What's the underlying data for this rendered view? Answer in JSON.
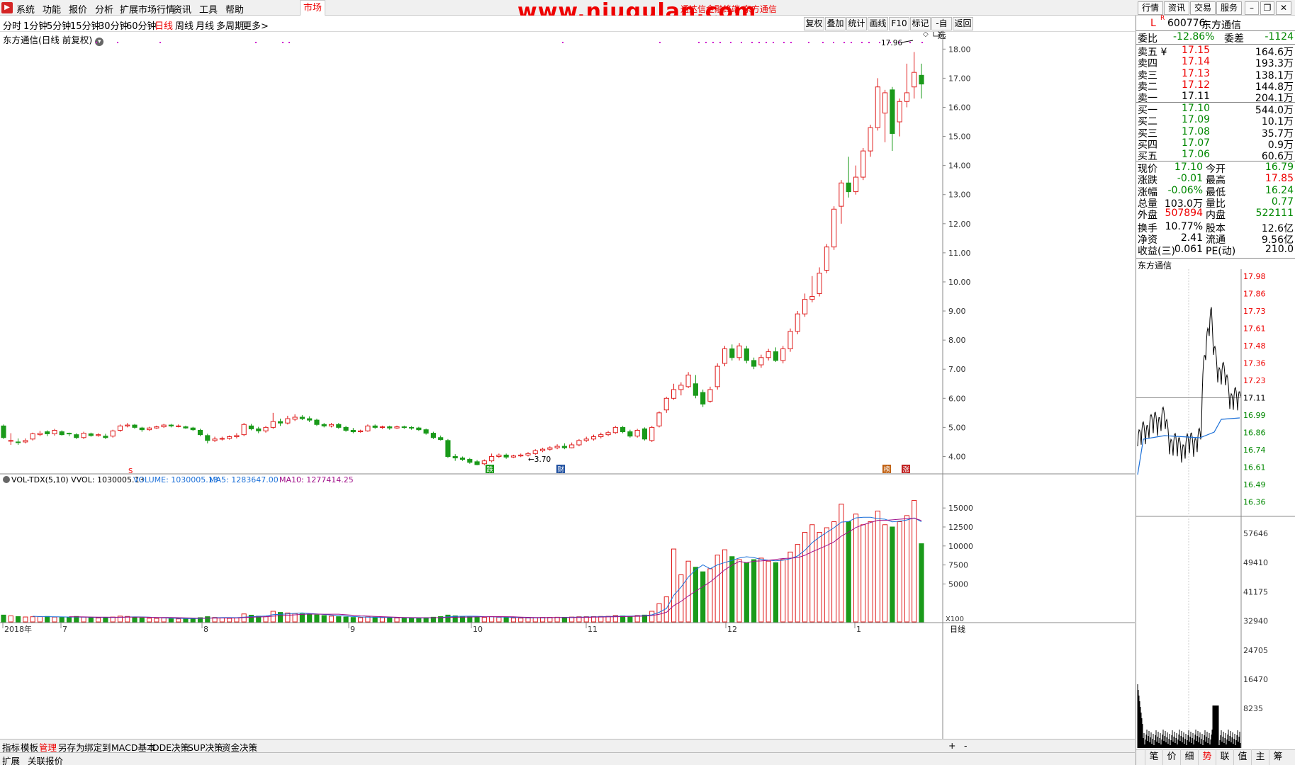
{
  "menu": [
    "系统",
    "功能",
    "报价",
    "分析",
    "扩展市场行情",
    "资讯",
    "工具",
    "帮助"
  ],
  "market_tab": "市场",
  "watermark": "www.niugulan.com",
  "window_title": "通达信金融终端 东方通信",
  "top_right": [
    "行情",
    "资讯",
    "交易",
    "服务"
  ],
  "periods": [
    "分时",
    "1分钟",
    "5分钟",
    "15分钟",
    "30分钟",
    "60分钟",
    "日线",
    "周线",
    "月线",
    "多周期",
    "更多>"
  ],
  "active_period": "日线",
  "tools": [
    "复权",
    "叠加",
    "统计",
    "画线",
    "F10",
    "标记",
    "-自选",
    "返回"
  ],
  "chart_title": "东方通信(日线 前复权)",
  "vol_label": {
    "name": "VOL-TDX(5,10)",
    "vvol": "VVOL: 1030005.13",
    "volume": "VOLUME: 1030005.13",
    "ma5": "MA5: 1283647.00",
    "ma10": "MA10: 1277414.25"
  },
  "vol_unit": "X100",
  "bottom_tabs": [
    "指标",
    "模板",
    "管理",
    "另存为",
    "绑定到",
    "MACD基本",
    "DDE决策",
    "SUP决策",
    "资金决策"
  ],
  "active_bottom_tab": "管理",
  "status": [
    "扩展",
    "关联报价"
  ],
  "daily_label": "日线",
  "markers": {
    "s": "S",
    "die": "跌",
    "cai": "财",
    "bang": "榜",
    "zhang": "涨",
    "low_label": "←3.70",
    "high_label": "17.96"
  },
  "quote": {
    "code_prefix": "L",
    "code_sup": "R",
    "code": "600776",
    "name": "东方通信",
    "weibi_label": "委比",
    "weibi": "-12.86%",
    "weicha_label": "委差",
    "weicha": "-1124",
    "asks": [
      {
        "label": "卖五",
        "price": "17.15",
        "vol": "164.6万"
      },
      {
        "label": "卖四",
        "price": "17.14",
        "vol": "193.3万"
      },
      {
        "label": "卖三",
        "price": "17.13",
        "vol": "138.1万"
      },
      {
        "label": "卖二",
        "price": "17.12",
        "vol": "144.8万"
      },
      {
        "label": "卖一",
        "price": "17.11",
        "vol": "204.1万"
      }
    ],
    "bids": [
      {
        "label": "买一",
        "price": "17.10",
        "vol": "544.0万"
      },
      {
        "label": "买二",
        "price": "17.09",
        "vol": "10.1万"
      },
      {
        "label": "买三",
        "price": "17.08",
        "vol": "35.7万"
      },
      {
        "label": "买四",
        "price": "17.07",
        "vol": "0.9万"
      },
      {
        "label": "买五",
        "price": "17.06",
        "vol": "60.6万"
      }
    ],
    "stats": [
      [
        "现价",
        "17.10",
        "今开",
        "16.79"
      ],
      [
        "涨跌",
        "-0.01",
        "最高",
        "17.85"
      ],
      [
        "涨幅",
        "-0.06%",
        "最低",
        "16.24"
      ],
      [
        "总量",
        "103.0万",
        "量比",
        "0.77"
      ],
      [
        "外盘",
        "507894",
        "内盘",
        "522111"
      ],
      [
        "换手",
        "10.77%",
        "股本",
        "12.6亿"
      ],
      [
        "净资",
        "2.41",
        "流通",
        "9.56亿"
      ],
      [
        "收益(三)",
        "0.061",
        "PE(动)",
        "210.0"
      ]
    ],
    "mini_title": "东方通信",
    "mini_price_ticks": [
      "17.98",
      "17.86",
      "17.73",
      "17.61",
      "17.48",
      "17.36",
      "17.23",
      "17.11",
      "16.99",
      "16.86",
      "16.74",
      "16.61",
      "16.49",
      "16.36"
    ],
    "mini_vol_ticks": [
      "57646",
      "49410",
      "41175",
      "32940",
      "24705",
      "16470",
      "8235"
    ],
    "bottom_tabs": [
      "笔",
      "价",
      "细",
      "势",
      "联",
      "值",
      "主",
      "筹"
    ]
  },
  "chart_data": {
    "type": "candlestick",
    "title": "东方通信(日线 前复权)",
    "price_axis": {
      "min": 3.5,
      "max": 18.3,
      "ticks": [
        4.0,
        5.0,
        6.0,
        7.0,
        8.0,
        9.0,
        10.0,
        11.0,
        12.0,
        13.0,
        14.0,
        15.0,
        16.0,
        17.0,
        18.0
      ]
    },
    "volume_axis": {
      "min": 0,
      "max": 18000,
      "ticks": [
        5000,
        7500,
        10000,
        12500,
        15000
      ]
    },
    "x_labels": [
      "2018年",
      "7",
      "8",
      "9",
      "10",
      "11",
      "12",
      "1"
    ],
    "candles": [
      [
        5.05,
        4.65,
        5.1,
        4.6,
        900
      ],
      [
        4.55,
        4.55,
        4.8,
        4.4,
        800
      ],
      [
        4.5,
        4.48,
        4.62,
        4.4,
        700
      ],
      [
        4.5,
        4.55,
        4.62,
        4.45,
        650
      ],
      [
        4.6,
        4.78,
        4.82,
        4.55,
        680
      ],
      [
        4.75,
        4.8,
        4.88,
        4.7,
        690
      ],
      [
        4.85,
        4.78,
        4.9,
        4.7,
        720
      ],
      [
        4.78,
        4.9,
        4.95,
        4.72,
        640
      ],
      [
        4.85,
        4.75,
        4.9,
        4.72,
        600
      ],
      [
        4.8,
        4.78,
        4.82,
        4.7,
        560
      ],
      [
        4.75,
        4.65,
        4.8,
        4.6,
        720
      ],
      [
        4.65,
        4.8,
        4.85,
        4.6,
        640
      ],
      [
        4.78,
        4.72,
        4.82,
        4.68,
        560
      ],
      [
        4.72,
        4.75,
        4.8,
        4.68,
        520
      ],
      [
        4.7,
        4.65,
        4.78,
        4.6,
        560
      ],
      [
        4.7,
        4.88,
        4.92,
        4.65,
        640
      ],
      [
        4.9,
        5.05,
        5.1,
        4.85,
        760
      ],
      [
        5.05,
        5.08,
        5.15,
        5.0,
        720
      ],
      [
        5.08,
        5.0,
        5.12,
        4.95,
        620
      ],
      [
        4.98,
        4.92,
        5.02,
        4.85,
        540
      ],
      [
        4.92,
        4.98,
        5.02,
        4.88,
        480
      ],
      [
        4.98,
        5.02,
        5.06,
        4.95,
        470
      ],
      [
        5.02,
        5.08,
        5.12,
        4.98,
        520
      ],
      [
        5.08,
        5.05,
        5.12,
        5.0,
        450
      ],
      [
        5.05,
        5.05,
        5.1,
        5.0,
        400
      ],
      [
        5.02,
        4.98,
        5.06,
        4.95,
        420
      ],
      [
        4.98,
        4.92,
        5.02,
        4.88,
        470
      ],
      [
        4.9,
        4.75,
        4.95,
        4.7,
        560
      ],
      [
        4.72,
        4.55,
        4.78,
        4.45,
        690
      ],
      [
        4.55,
        4.6,
        4.68,
        4.5,
        590
      ],
      [
        4.6,
        4.62,
        4.68,
        4.55,
        520
      ],
      [
        4.62,
        4.68,
        4.72,
        4.58,
        470
      ],
      [
        4.68,
        4.72,
        4.8,
        4.62,
        520
      ],
      [
        4.75,
        5.1,
        5.15,
        4.7,
        1050
      ],
      [
        5.05,
        4.95,
        5.12,
        4.9,
        890
      ],
      [
        4.95,
        4.88,
        5.02,
        4.8,
        760
      ],
      [
        4.88,
        5.0,
        5.05,
        4.82,
        690
      ],
      [
        5.0,
        5.2,
        5.5,
        4.95,
        1400
      ],
      [
        5.2,
        5.15,
        5.3,
        5.05,
        1250
      ],
      [
        5.15,
        5.3,
        5.4,
        5.1,
        1180
      ],
      [
        5.28,
        5.35,
        5.45,
        5.22,
        1100
      ],
      [
        5.35,
        5.3,
        5.42,
        5.25,
        1050
      ],
      [
        5.3,
        5.25,
        5.38,
        5.18,
        980
      ],
      [
        5.25,
        5.1,
        5.3,
        5.05,
        920
      ],
      [
        5.1,
        5.05,
        5.15,
        5.0,
        840
      ],
      [
        5.05,
        5.1,
        5.15,
        5.0,
        760
      ],
      [
        5.1,
        5.0,
        5.15,
        4.95,
        690
      ],
      [
        5.0,
        4.9,
        5.05,
        4.85,
        650
      ],
      [
        4.9,
        4.85,
        4.98,
        4.8,
        590
      ],
      [
        4.85,
        4.88,
        4.92,
        4.82,
        560
      ],
      [
        4.88,
        5.05,
        5.1,
        4.85,
        670
      ],
      [
        5.05,
        5.0,
        5.1,
        4.95,
        620
      ],
      [
        5.0,
        5.02,
        5.06,
        4.95,
        570
      ],
      [
        5.02,
        4.98,
        5.06,
        4.92,
        540
      ],
      [
        4.98,
        5.02,
        5.06,
        4.95,
        520
      ],
      [
        5.02,
        5.0,
        5.06,
        4.95,
        500
      ],
      [
        5.0,
        4.98,
        5.04,
        4.92,
        480
      ],
      [
        4.98,
        4.92,
        5.02,
        4.88,
        510
      ],
      [
        4.92,
        4.8,
        4.96,
        4.75,
        560
      ],
      [
        4.8,
        4.65,
        4.85,
        4.6,
        620
      ],
      [
        4.65,
        4.58,
        4.72,
        4.55,
        700
      ],
      [
        4.55,
        4.0,
        4.6,
        3.95,
        900
      ],
      [
        4.0,
        3.95,
        4.08,
        3.85,
        800
      ],
      [
        3.95,
        3.9,
        4.0,
        3.85,
        720
      ],
      [
        3.9,
        3.8,
        3.95,
        3.75,
        680
      ],
      [
        3.82,
        3.72,
        3.88,
        3.7,
        640
      ],
      [
        3.75,
        3.85,
        3.9,
        3.7,
        600
      ],
      [
        3.85,
        4.0,
        4.1,
        3.8,
        700
      ],
      [
        4.0,
        4.05,
        4.1,
        3.95,
        620
      ],
      [
        4.05,
        3.98,
        4.1,
        3.92,
        560
      ],
      [
        3.98,
        4.02,
        4.06,
        3.95,
        520
      ],
      [
        4.02,
        4.05,
        4.1,
        3.98,
        500
      ],
      [
        4.05,
        4.1,
        4.15,
        4.0,
        520
      ],
      [
        4.1,
        4.2,
        4.25,
        4.05,
        560
      ],
      [
        4.2,
        4.25,
        4.3,
        4.15,
        590
      ],
      [
        4.25,
        4.3,
        4.35,
        4.2,
        600
      ],
      [
        4.3,
        4.35,
        4.42,
        4.25,
        620
      ],
      [
        4.35,
        4.3,
        4.45,
        4.25,
        610
      ],
      [
        4.3,
        4.4,
        4.48,
        4.28,
        640
      ],
      [
        4.4,
        4.55,
        4.6,
        4.35,
        680
      ],
      [
        4.55,
        4.6,
        4.68,
        4.5,
        690
      ],
      [
        4.6,
        4.68,
        4.75,
        4.55,
        700
      ],
      [
        4.68,
        4.75,
        4.82,
        4.62,
        720
      ],
      [
        4.75,
        4.82,
        4.88,
        4.7,
        740
      ],
      [
        4.82,
        5.0,
        5.05,
        4.78,
        850
      ],
      [
        5.0,
        4.85,
        5.05,
        4.8,
        790
      ],
      [
        4.85,
        4.7,
        4.92,
        4.65,
        740
      ],
      [
        4.7,
        4.9,
        4.95,
        4.65,
        850
      ],
      [
        4.95,
        4.6,
        5.0,
        4.55,
        900
      ],
      [
        4.55,
        5.0,
        5.05,
        4.5,
        1400
      ],
      [
        5.05,
        5.5,
        5.55,
        5.0,
        2400
      ],
      [
        5.6,
        6.0,
        6.05,
        5.5,
        3300
      ],
      [
        6.0,
        6.3,
        6.5,
        5.95,
        9600
      ],
      [
        6.3,
        6.45,
        6.55,
        6.1,
        6200
      ],
      [
        6.4,
        6.8,
        6.9,
        6.35,
        8000
      ],
      [
        6.5,
        6.1,
        6.8,
        6.0,
        7200
      ],
      [
        6.2,
        5.8,
        6.3,
        5.7,
        6600
      ],
      [
        5.9,
        6.3,
        6.4,
        5.85,
        7000
      ],
      [
        6.4,
        7.1,
        7.2,
        6.3,
        8800
      ],
      [
        7.2,
        7.7,
        7.8,
        7.1,
        9500
      ],
      [
        7.7,
        7.4,
        7.85,
        7.3,
        8600
      ],
      [
        7.4,
        7.8,
        7.9,
        7.3,
        8200
      ],
      [
        7.7,
        7.3,
        7.8,
        7.2,
        7800
      ],
      [
        7.3,
        7.1,
        7.4,
        7.0,
        8200
      ],
      [
        7.15,
        7.4,
        7.5,
        7.05,
        8400
      ],
      [
        7.4,
        7.6,
        7.7,
        7.3,
        8000
      ],
      [
        7.6,
        7.3,
        7.75,
        7.25,
        7800
      ],
      [
        7.3,
        7.7,
        7.8,
        7.2,
        8200
      ],
      [
        7.7,
        8.3,
        8.4,
        7.6,
        9200
      ],
      [
        8.3,
        8.9,
        9.0,
        8.2,
        10200
      ],
      [
        8.9,
        9.4,
        9.6,
        8.8,
        11800
      ],
      [
        9.4,
        9.5,
        10.2,
        9.3,
        12800
      ],
      [
        9.6,
        10.3,
        10.5,
        9.5,
        11800
      ],
      [
        10.4,
        11.2,
        11.3,
        10.3,
        12400
      ],
      [
        11.2,
        12.5,
        12.6,
        11.1,
        13200
      ],
      [
        12.6,
        13.4,
        13.5,
        12.0,
        15500
      ],
      [
        13.4,
        13.1,
        14.3,
        12.9,
        13200
      ],
      [
        13.1,
        13.6,
        14.0,
        13.0,
        14200
      ],
      [
        13.6,
        14.5,
        14.6,
        13.5,
        12800
      ],
      [
        14.5,
        15.3,
        15.4,
        14.3,
        13200
      ],
      [
        15.3,
        16.7,
        17.0,
        15.2,
        14600
      ],
      [
        15.8,
        16.5,
        16.6,
        14.8,
        12800
      ],
      [
        16.6,
        15.1,
        16.7,
        14.5,
        12500
      ],
      [
        15.5,
        16.2,
        16.3,
        15.0,
        13200
      ],
      [
        16.2,
        16.5,
        17.5,
        16.0,
        14000
      ],
      [
        16.7,
        17.2,
        17.9,
        16.3,
        16000
      ],
      [
        17.1,
        16.8,
        17.5,
        16.3,
        10300
      ]
    ]
  }
}
